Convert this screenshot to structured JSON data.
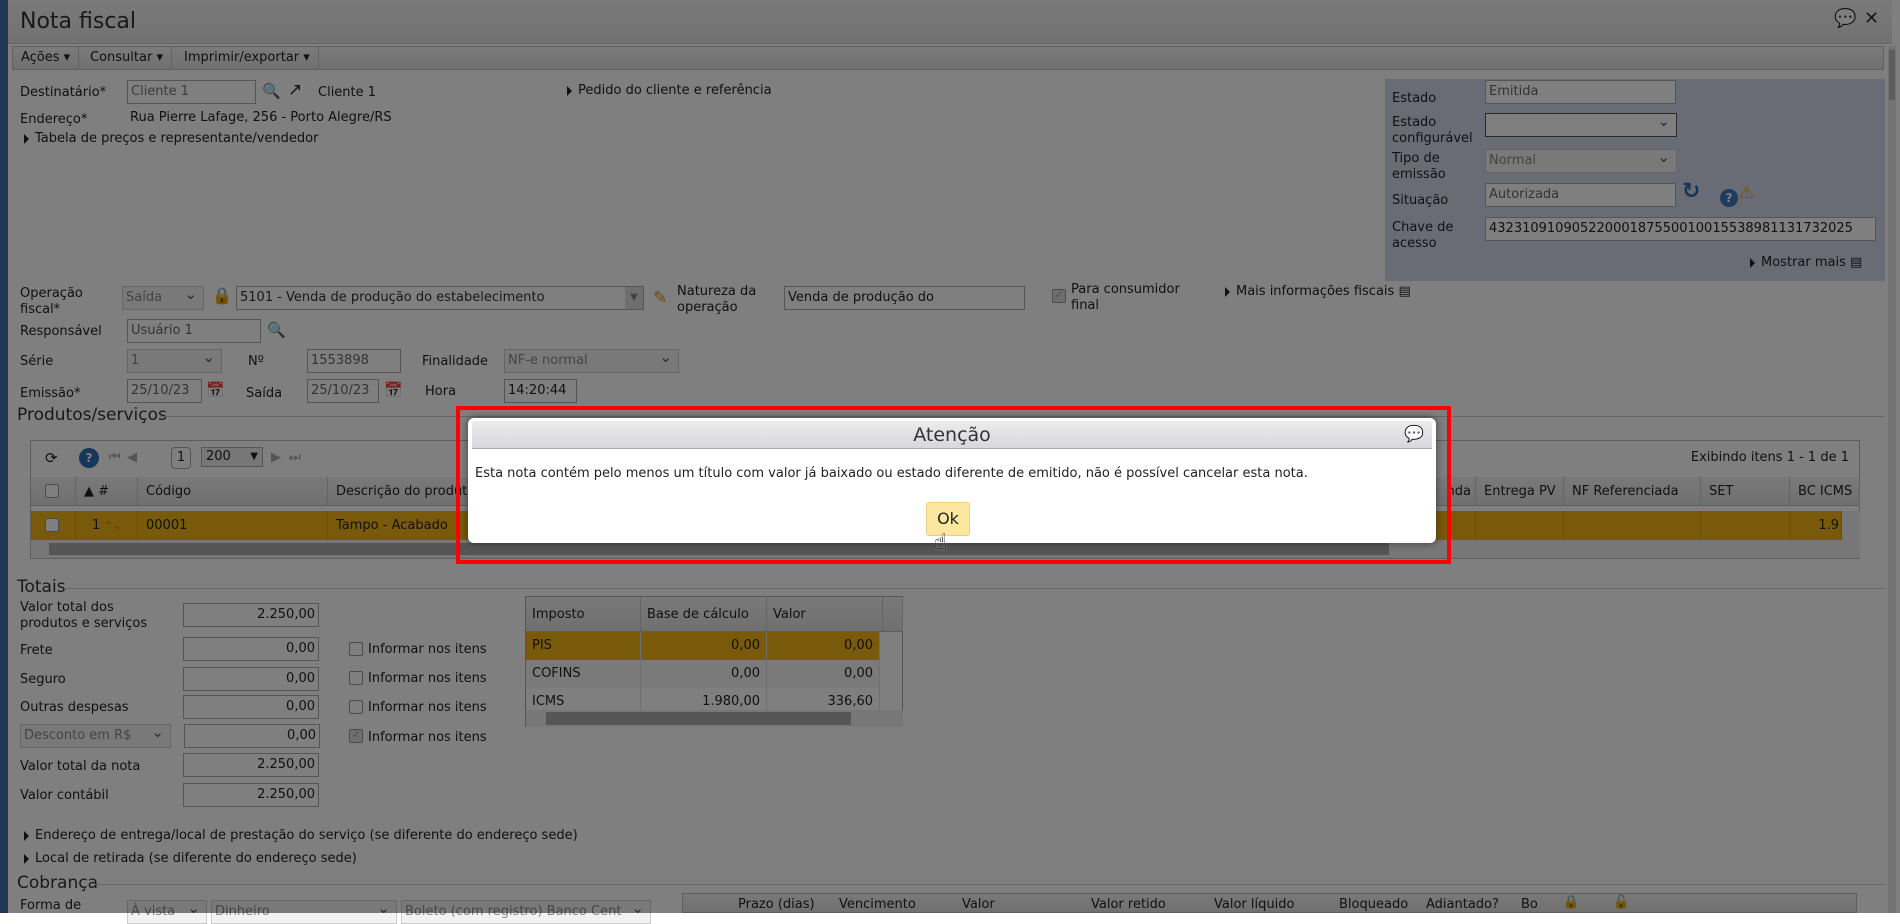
{
  "window": {
    "title": "Nota fiscal"
  },
  "menu": [
    {
      "label": "Ações"
    },
    {
      "label": "Consultar"
    },
    {
      "label": "Imprimir/exportar"
    }
  ],
  "header": {
    "destinatario_label": "Destinatário*",
    "destinatario_value": "Cliente 1",
    "destinatario_link": "Cliente 1",
    "endereco_label": "Endereço*",
    "endereco_value": "Rua Pierre Lafage, 256 - Porto Alegre/RS",
    "tabela_link": "Tabela de preços e representante/vendedor",
    "pedido_link": "Pedido do cliente e referência"
  },
  "status_panel": {
    "estado_label": "Estado",
    "estado_value": "Emitida",
    "estado_conf_label1": "Estado",
    "estado_conf_label2": "configurável",
    "estado_conf_value": "",
    "tipo_label1": "Tipo de",
    "tipo_label2": "emissão",
    "tipo_value": "Normal",
    "situacao_label": "Situação",
    "situacao_value": "Autorizada",
    "chave_label1": "Chave de",
    "chave_label2": "acesso",
    "chave_value": "43231091090522000187550010015538981131732025",
    "mostrar_mais": "Mostrar mais"
  },
  "fiscal": {
    "operacao_label1": "Operação",
    "operacao_label2": "fiscal*",
    "tipo_value": "Saída",
    "operacao_value": "5101 - Venda de produção do estabelecimento",
    "natureza_label1": "Natureza da",
    "natureza_label2": "operação",
    "natureza_value": "Venda de produção do estabelecimento",
    "consumidor_label1": "Para consumidor",
    "consumidor_label2": "final",
    "consumidor_checked": true,
    "mais_info": "Mais informações fiscais",
    "responsavel_label": "Responsável",
    "responsavel_value": "Usuário 1",
    "serie_label": "Série",
    "serie_value": "1",
    "numero_label": "Nº",
    "numero_value": "1553898",
    "finalidade_label": "Finalidade",
    "finalidade_value": "NF-e normal",
    "emissao_label": "Emissão*",
    "emissao_value": "25/10/23",
    "saida_label": "Saída",
    "saida_value": "25/10/23",
    "hora_label": "Hora",
    "hora_value": "14:20:44"
  },
  "produtos": {
    "title": "Produtos/serviços",
    "page": "1",
    "page_size": "200",
    "summary": "Exibindo itens 1 - 1 de 1",
    "columns": [
      "#",
      "Código",
      "Descrição do produto",
      "nda",
      "Entrega PV",
      "NF Referenciada",
      "SET",
      "BC ICMS"
    ],
    "rows": [
      {
        "n": "1",
        "codigo": "00001",
        "descricao": "Tampo - Acabado",
        "bc_icms": "1.9"
      }
    ],
    "highlight_color": "#f0b414"
  },
  "dialog": {
    "title": "Atenção",
    "message": "Esta nota contém pelo menos um título com valor já baixado ou estado diferente de emitido, não é possível cancelar esta nota.",
    "ok_label": "Ok",
    "highlight_color": "#ff0000"
  },
  "totais": {
    "title": "Totais",
    "valor_total_label1": "Valor total dos",
    "valor_total_label2": "produtos e serviços",
    "valor_total": "2.250,00",
    "frete_label": "Frete",
    "frete": "0,00",
    "seguro_label": "Seguro",
    "seguro": "0,00",
    "outras_label": "Outras despesas",
    "outras": "0,00",
    "desconto_type": "Desconto em R$",
    "desconto": "0,00",
    "total_nota_label": "Valor total da nota",
    "total_nota": "2.250,00",
    "contabil_label": "Valor contábil",
    "contabil": "2.250,00",
    "informar_label": "Informar nos itens",
    "informar_checked": [
      false,
      false,
      false,
      true
    ]
  },
  "impostos": {
    "columns": [
      "Imposto",
      "Base de cálculo",
      "Valor"
    ],
    "rows": [
      {
        "imposto": "PIS",
        "base": "0,00",
        "valor": "0,00"
      },
      {
        "imposto": "COFINS",
        "base": "0,00",
        "valor": "0,00"
      },
      {
        "imposto": "ICMS",
        "base": "1.980,00",
        "valor": "336,60"
      }
    ]
  },
  "links": {
    "entrega": "Endereço de entrega/local de prestação do serviço (se diferente do endereço sede)",
    "retirada": "Local de retirada (se diferente do endereço sede)"
  },
  "cobranca": {
    "title": "Cobrança",
    "forma_label": "Forma de",
    "forma_value": "À vista",
    "meio_value": "Dinheiro",
    "conta_value": "Boleto (com registro) Banco Cent",
    "columns": [
      "Prazo (dias)",
      "Vencimento",
      "Valor",
      "Valor retido",
      "Valor líquido",
      "Bloqueado",
      "Adiantado?",
      "Bo"
    ]
  }
}
